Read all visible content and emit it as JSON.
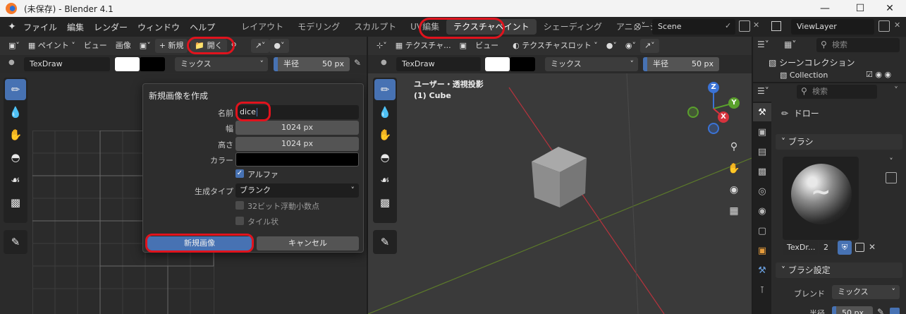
{
  "window": {
    "title": "(未保存) - Blender 4.1"
  },
  "menu": [
    "ファイル",
    "編集",
    "レンダー",
    "ウィンドウ",
    "ヘルプ"
  ],
  "workspaces": [
    "レイアウト",
    "モデリング",
    "スカルプト",
    "UV編集",
    "テクスチャペイント",
    "シェーディング",
    "アニメーショ"
  ],
  "scene": "Scene",
  "view_layer": "ViewLayer",
  "image_editor": {
    "mode": "ペイント",
    "view": "ビュー",
    "image": "画像",
    "new": "新規",
    "open": "開く",
    "brush_name": "TexDraw",
    "blend": "ミックス",
    "radius_label": "半径",
    "radius_value": "50 px"
  },
  "dialog": {
    "title": "新規画像を作成",
    "name_label": "名前",
    "name_value": "dice",
    "width_label": "幅",
    "width_value": "1024 px",
    "height_label": "高さ",
    "height_value": "1024 px",
    "color_label": "カラー",
    "alpha_label": "アルファ",
    "gen_type_label": "生成タイプ",
    "gen_type_value": "ブランク",
    "float_label": "32ビット浮動小数点",
    "tiled_label": "タイル状",
    "ok_label": "新規画像",
    "cancel_label": "キャンセル"
  },
  "viewport": {
    "mode": "テクスチャ...",
    "view": "ビュー",
    "slot": "テクスチャスロット",
    "brush_name": "TexDraw",
    "blend": "ミックス",
    "radius_label": "半径",
    "radius_value": "50 px",
    "overlay_title": "ユーザー・透視投影",
    "overlay_object": "(1) Cube",
    "axes": {
      "x": "X",
      "y": "Y",
      "z": "Z"
    }
  },
  "outliner": {
    "search_placeholder": "検索",
    "scene_collection": "シーンコレクション",
    "collection": "Collection"
  },
  "properties": {
    "search_placeholder": "検索",
    "tool_name": "ドロー",
    "brush_panel": "ブラシ",
    "brush_name": "TexDr...",
    "brush_users": "2",
    "brush_settings_panel": "ブラシ設定",
    "blend_label": "ブレンド",
    "blend_value": "ミックス",
    "radius_label": "半径",
    "radius_value": "50 px"
  },
  "colors": {
    "accent": "#4772b3",
    "highlight_ring": "#e0131d",
    "active_tab": "#3d3d3d"
  }
}
